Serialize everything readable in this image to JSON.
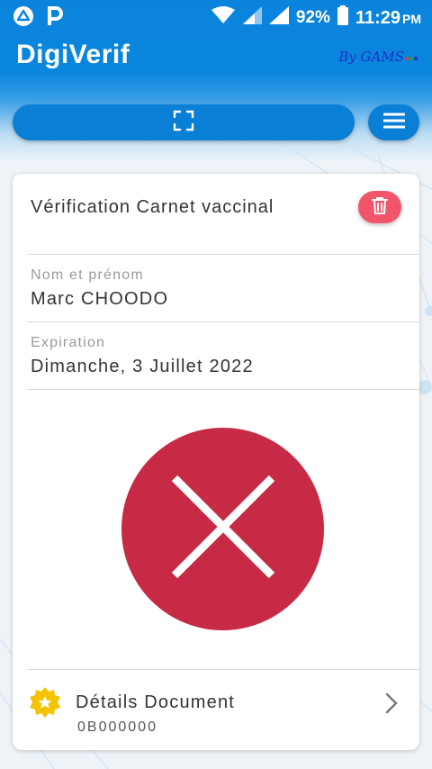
{
  "status_bar": {
    "battery": "92%",
    "time": "11:29",
    "ampm": "PM"
  },
  "header": {
    "app_title": "DigiVerif",
    "brand": "By GAMS",
    "brand_dot_colors": [
      "#e23b3b",
      "#2a9d4a",
      "#1c2fc8"
    ]
  },
  "scan_bar": {
    "icon": "scan-icon"
  },
  "menu": {
    "icon": "hamburger-menu-icon"
  },
  "card": {
    "title": "Vérification Carnet vaccinal",
    "delete_icon": "trash-icon",
    "fields": [
      {
        "label": "Nom et prénom",
        "value": "Marc CHOODO"
      },
      {
        "label": "Expiration",
        "value": "Dimanche, 3 Juillet 2022"
      }
    ],
    "status": {
      "icon": "cross-icon",
      "color": "#c62a44"
    },
    "details": {
      "icon": "star-badge-icon",
      "title": "Détails Document",
      "document_id": "0B000000"
    }
  },
  "colors": {
    "primary": "#0a7fd6",
    "delete": "#f2556a",
    "invalid": "#c62a44",
    "star": "#f5c400"
  }
}
